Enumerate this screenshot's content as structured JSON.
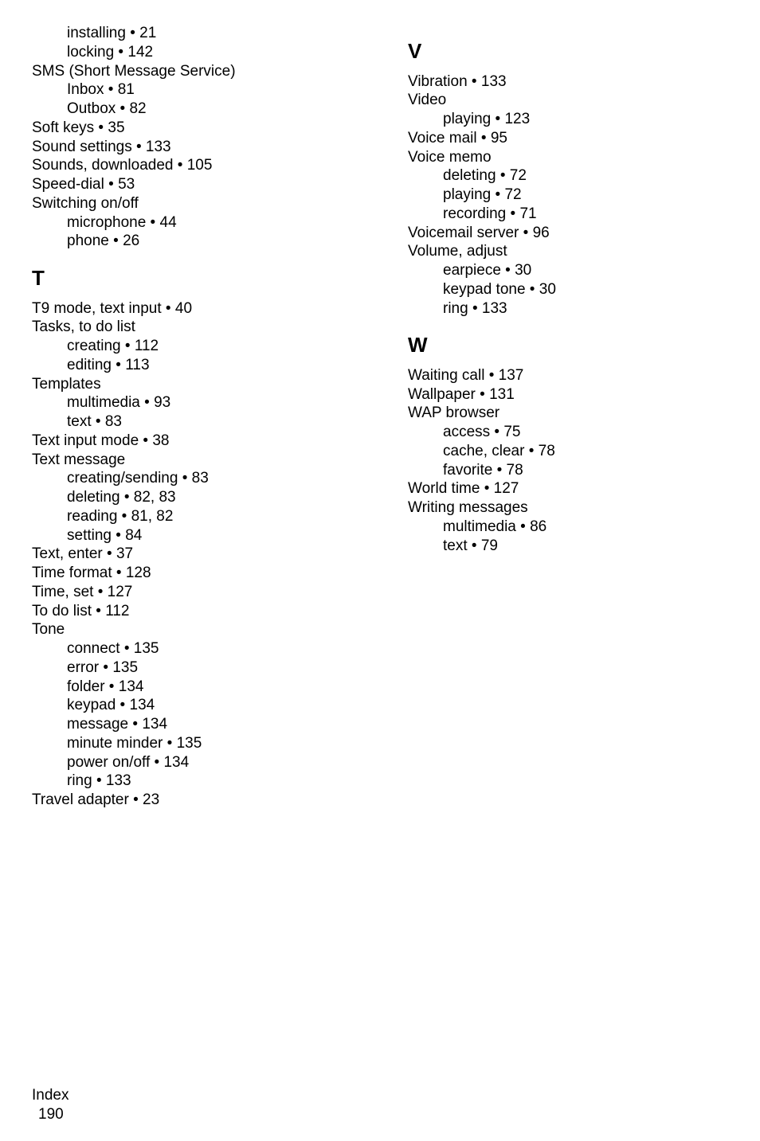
{
  "col1": {
    "sContinued": [
      {
        "text": "installing",
        "sep": " •  ",
        "page": "21",
        "indent": true
      },
      {
        "text": "locking",
        "sep": " •  ",
        "page": "142",
        "indent": true
      },
      {
        "text": "SMS (Short Message Service)",
        "sep": "",
        "page": "",
        "indent": false
      },
      {
        "text": "Inbox",
        "sep": " •  ",
        "page": "81",
        "indent": true
      },
      {
        "text": "Outbox",
        "sep": " •  ",
        "page": "82",
        "indent": true
      },
      {
        "text": "Soft keys",
        "sep": " •  ",
        "page": "35",
        "indent": false
      },
      {
        "text": "Sound settings",
        "sep": " •  ",
        "page": "133",
        "indent": false
      },
      {
        "text": "Sounds, downloaded",
        "sep": " •  ",
        "page": "105",
        "indent": false
      },
      {
        "text": "Speed-dial",
        "sep": " •  ",
        "page": "53",
        "indent": false
      },
      {
        "text": "Switching on/off",
        "sep": "",
        "page": "",
        "indent": false
      },
      {
        "text": "microphone",
        "sep": " •  ",
        "page": "44",
        "indent": true
      },
      {
        "text": "phone",
        "sep": " •  ",
        "page": "26",
        "indent": true
      }
    ],
    "tHeading": "T",
    "tEntries": [
      {
        "text": "T9 mode, text input",
        "sep": " •  ",
        "page": "40",
        "indent": false
      },
      {
        "text": "Tasks, to do list",
        "sep": "",
        "page": "",
        "indent": false
      },
      {
        "text": "creating",
        "sep": " •  ",
        "page": "112",
        "indent": true
      },
      {
        "text": "editing",
        "sep": " •  ",
        "page": "113",
        "indent": true
      },
      {
        "text": "Templates",
        "sep": "",
        "page": "",
        "indent": false
      },
      {
        "text": "multimedia",
        "sep": " •  ",
        "page": "93",
        "indent": true
      },
      {
        "text": "text",
        "sep": " •  ",
        "page": "83",
        "indent": true
      },
      {
        "text": "Text input mode",
        "sep": " •  ",
        "page": "38",
        "indent": false
      },
      {
        "text": "Text message",
        "sep": "",
        "page": "",
        "indent": false
      },
      {
        "text": "creating/sending",
        "sep": " •  ",
        "page": "83",
        "indent": true
      },
      {
        "text": "deleting",
        "sep": " •  ",
        "page": "82, 83",
        "indent": true
      },
      {
        "text": "reading",
        "sep": " •  ",
        "page": "81, 82",
        "indent": true
      },
      {
        "text": "setting",
        "sep": " •  ",
        "page": "84",
        "indent": true
      },
      {
        "text": "Text, enter",
        "sep": " •  ",
        "page": "37",
        "indent": false
      },
      {
        "text": "Time format",
        "sep": " •  ",
        "page": "128",
        "indent": false
      },
      {
        "text": "Time, set",
        "sep": " •  ",
        "page": "127",
        "indent": false
      },
      {
        "text": "To do list",
        "sep": " •  ",
        "page": "112",
        "indent": false
      },
      {
        "text": "Tone",
        "sep": "",
        "page": "",
        "indent": false
      },
      {
        "text": "connect",
        "sep": " •  ",
        "page": "135",
        "indent": true
      },
      {
        "text": "error",
        "sep": " •  ",
        "page": "135",
        "indent": true
      },
      {
        "text": "folder",
        "sep": " •  ",
        "page": "134",
        "indent": true
      },
      {
        "text": "keypad",
        "sep": " •  ",
        "page": "134",
        "indent": true
      },
      {
        "text": "message",
        "sep": " •  ",
        "page": "134",
        "indent": true
      },
      {
        "text": "minute minder",
        "sep": " •  ",
        "page": "135",
        "indent": true
      },
      {
        "text": "power on/off",
        "sep": " •  ",
        "page": "134",
        "indent": true
      },
      {
        "text": "ring",
        "sep": " •  ",
        "page": "133",
        "indent": true
      },
      {
        "text": "Travel adapter",
        "sep": " •  ",
        "page": "23",
        "indent": false
      }
    ]
  },
  "col2": {
    "vHeading": "V",
    "vEntries": [
      {
        "text": "Vibration",
        "sep": " •  ",
        "page": "133",
        "indent": false
      },
      {
        "text": "Video",
        "sep": "",
        "page": "",
        "indent": false
      },
      {
        "text": "playing",
        "sep": " •  ",
        "page": "123",
        "indent": true
      },
      {
        "text": "Voice mail",
        "sep": " •  ",
        "page": "95",
        "indent": false
      },
      {
        "text": "Voice memo",
        "sep": "",
        "page": "",
        "indent": false
      },
      {
        "text": "deleting",
        "sep": " •  ",
        "page": "72",
        "indent": true
      },
      {
        "text": "playing",
        "sep": " •  ",
        "page": "72",
        "indent": true
      },
      {
        "text": "recording",
        "sep": " •  ",
        "page": "71",
        "indent": true
      },
      {
        "text": "Voicemail server",
        "sep": " •  ",
        "page": "96",
        "indent": false
      },
      {
        "text": "Volume, adjust",
        "sep": "",
        "page": "",
        "indent": false
      },
      {
        "text": "earpiece",
        "sep": " •  ",
        "page": "30",
        "indent": true
      },
      {
        "text": "keypad tone",
        "sep": " •  ",
        "page": "30",
        "indent": true
      },
      {
        "text": "ring",
        "sep": " •  ",
        "page": "133",
        "indent": true
      }
    ],
    "wHeading": "W",
    "wEntries": [
      {
        "text": "Waiting call",
        "sep": " •  ",
        "page": "137",
        "indent": false
      },
      {
        "text": "Wallpaper",
        "sep": " •  ",
        "page": "131",
        "indent": false
      },
      {
        "text": "WAP browser",
        "sep": "",
        "page": "",
        "indent": false
      },
      {
        "text": "access",
        "sep": " •  ",
        "page": "75",
        "indent": true
      },
      {
        "text": "cache, clear",
        "sep": " •  ",
        "page": "78",
        "indent": true
      },
      {
        "text": "favorite",
        "sep": " •  ",
        "page": "78",
        "indent": true
      },
      {
        "text": "World time",
        "sep": " •  ",
        "page": "127",
        "indent": false
      },
      {
        "text": "Writing messages",
        "sep": "",
        "page": "",
        "indent": false
      },
      {
        "text": "multimedia",
        "sep": " •  ",
        "page": "86",
        "indent": true
      },
      {
        "text": "text",
        "sep": " •  ",
        "page": "79",
        "indent": true
      }
    ]
  },
  "footer": {
    "label": "Index",
    "pageNumber": "190"
  }
}
